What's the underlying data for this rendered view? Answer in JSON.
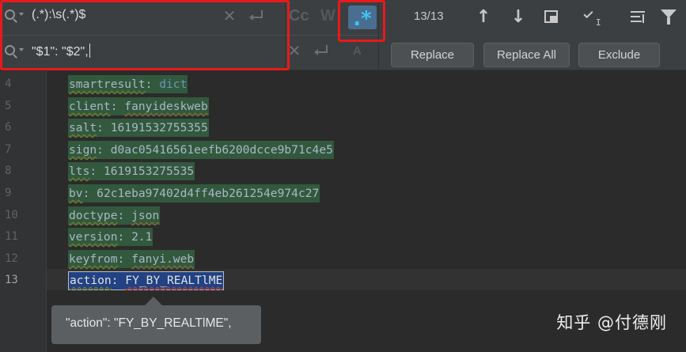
{
  "find": {
    "search_value": "(.*):\\s(.*)$",
    "replace_value": "\"$1\": \"$2\","
  },
  "options": {
    "match_case_label": "Cc",
    "words_label": "W",
    "regex_label": ".*",
    "preserve_case_label": "A"
  },
  "match_count": "13/13",
  "buttons": {
    "replace": "Replace",
    "replace_all": "Replace All",
    "exclude": "Exclude"
  },
  "icons": {
    "search": "search-icon",
    "clear": "close-icon",
    "enter": "enter-newline-icon",
    "prev": "arrow-up-icon",
    "next": "arrow-down-icon",
    "select_all": "select-all-occurrences-icon",
    "in_selection": "in-selection-icon",
    "align": "multiline-icon",
    "filter": "filter-icon"
  },
  "editor": {
    "lines": [
      {
        "num": "4",
        "key": "smartresult",
        "value": "dict"
      },
      {
        "num": "5",
        "key": "client",
        "value": "fanyideskweb"
      },
      {
        "num": "6",
        "key": "salt",
        "value": "16191532755355"
      },
      {
        "num": "7",
        "key": "sign",
        "value": "d0ac05416561eefb6200dcce9b71c4e5"
      },
      {
        "num": "8",
        "key": "lts",
        "value": "1619153275535"
      },
      {
        "num": "9",
        "key": "bv",
        "value": "62c1eba97402d4ff4eb261254e974c27"
      },
      {
        "num": "10",
        "key": "doctype",
        "value": "json"
      },
      {
        "num": "11",
        "key": "version",
        "value": "2.1"
      },
      {
        "num": "12",
        "key": "keyfrom",
        "value": "fanyi.web"
      },
      {
        "num": "13",
        "key": "action",
        "value": "FY_BY_REALTlME"
      }
    ],
    "separator": ": ",
    "tooltip": "\"action\": \"FY_BY_REALTlME\","
  },
  "watermark": "知乎 @付德刚",
  "colors": {
    "highlight": "#32593d",
    "selection": "#214283",
    "regex_active": "#40c2f5",
    "annotation": "#e8191b"
  }
}
